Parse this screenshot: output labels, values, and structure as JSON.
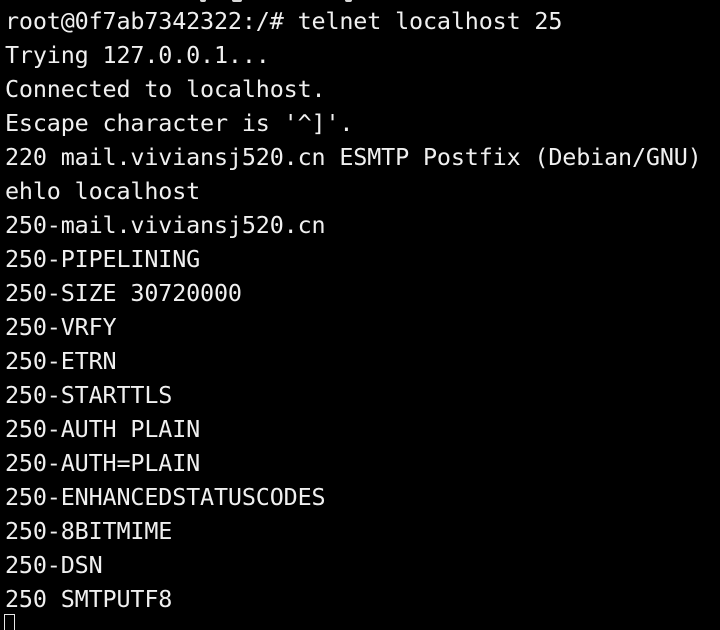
{
  "colors": {
    "background": "#000000",
    "foreground": "#f0f0f0"
  },
  "terminal": {
    "lines": [
      "root@0f7ab7342322:/# telnet localhost 25",
      "Trying 127.0.0.1...",
      "Connected to localhost.",
      "Escape character is '^]'.",
      "220 mail.viviansj520.cn ESMTP Postfix (Debian/GNU)",
      "ehlo localhost",
      "250-mail.viviansj520.cn",
      "250-PIPELINING",
      "250-SIZE 30720000",
      "250-VRFY",
      "250-ETRN",
      "250-STARTTLS",
      "250-AUTH PLAIN",
      "250-AUTH=PLAIN",
      "250-ENHANCEDSTATUSCODES",
      "250-8BITMIME",
      "250-DSN",
      "250 SMTPUTF8"
    ],
    "cursor_icon": "block-cursor-icon"
  }
}
